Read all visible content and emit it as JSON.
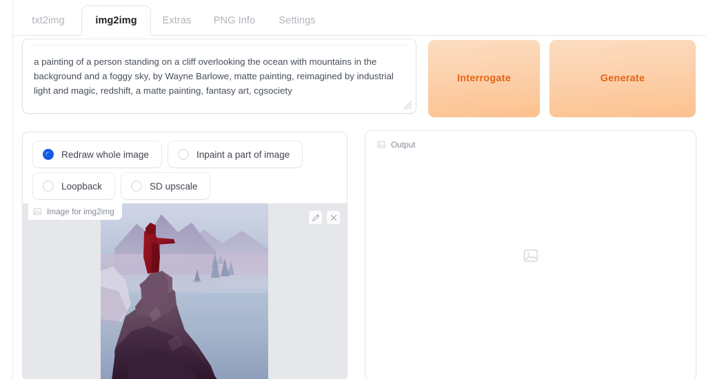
{
  "tabs": [
    {
      "label": "txt2img",
      "active": false
    },
    {
      "label": "img2img",
      "active": true
    },
    {
      "label": "Extras",
      "active": false
    },
    {
      "label": "PNG Info",
      "active": false
    },
    {
      "label": "Settings",
      "active": false
    }
  ],
  "prompt": {
    "value": "a painting of a person standing on a cliff overlooking the ocean with mountains in the background and a foggy sky, by Wayne Barlowe, matte painting, reimagined by industrial light and magic, redshift, a matte painting, fantasy art, cgsociety",
    "placeholder": "Prompt",
    "resize_handle": "resize-grip-icon"
  },
  "actions": {
    "interrogate_label": "Interrogate",
    "generate_label": "Generate",
    "button_text_color": "#e2661a",
    "button_gradient_top": "#fcdcc0",
    "button_gradient_bottom": "#fcc18e"
  },
  "mode_options": [
    {
      "label": "Redraw whole image",
      "checked": true
    },
    {
      "label": "Inpaint a part of image",
      "checked": false
    },
    {
      "label": "Loopback",
      "checked": false
    },
    {
      "label": "SD upscale",
      "checked": false
    }
  ],
  "accent_color": "#1559e8",
  "input_panel": {
    "tag_label": "Image for img2img",
    "tag_icon": "image-icon",
    "edit_icon": "pencil-icon",
    "close_icon": "close-icon",
    "letterbox_color": "#e6e7ea",
    "image_alt": "a painting of a red-robed figure standing on a rocky cliff overlooking a misty ocean with mountains"
  },
  "output_panel": {
    "tag_label": "Output",
    "tag_icon": "image-icon",
    "placeholder_icon": "image-placeholder-icon"
  }
}
